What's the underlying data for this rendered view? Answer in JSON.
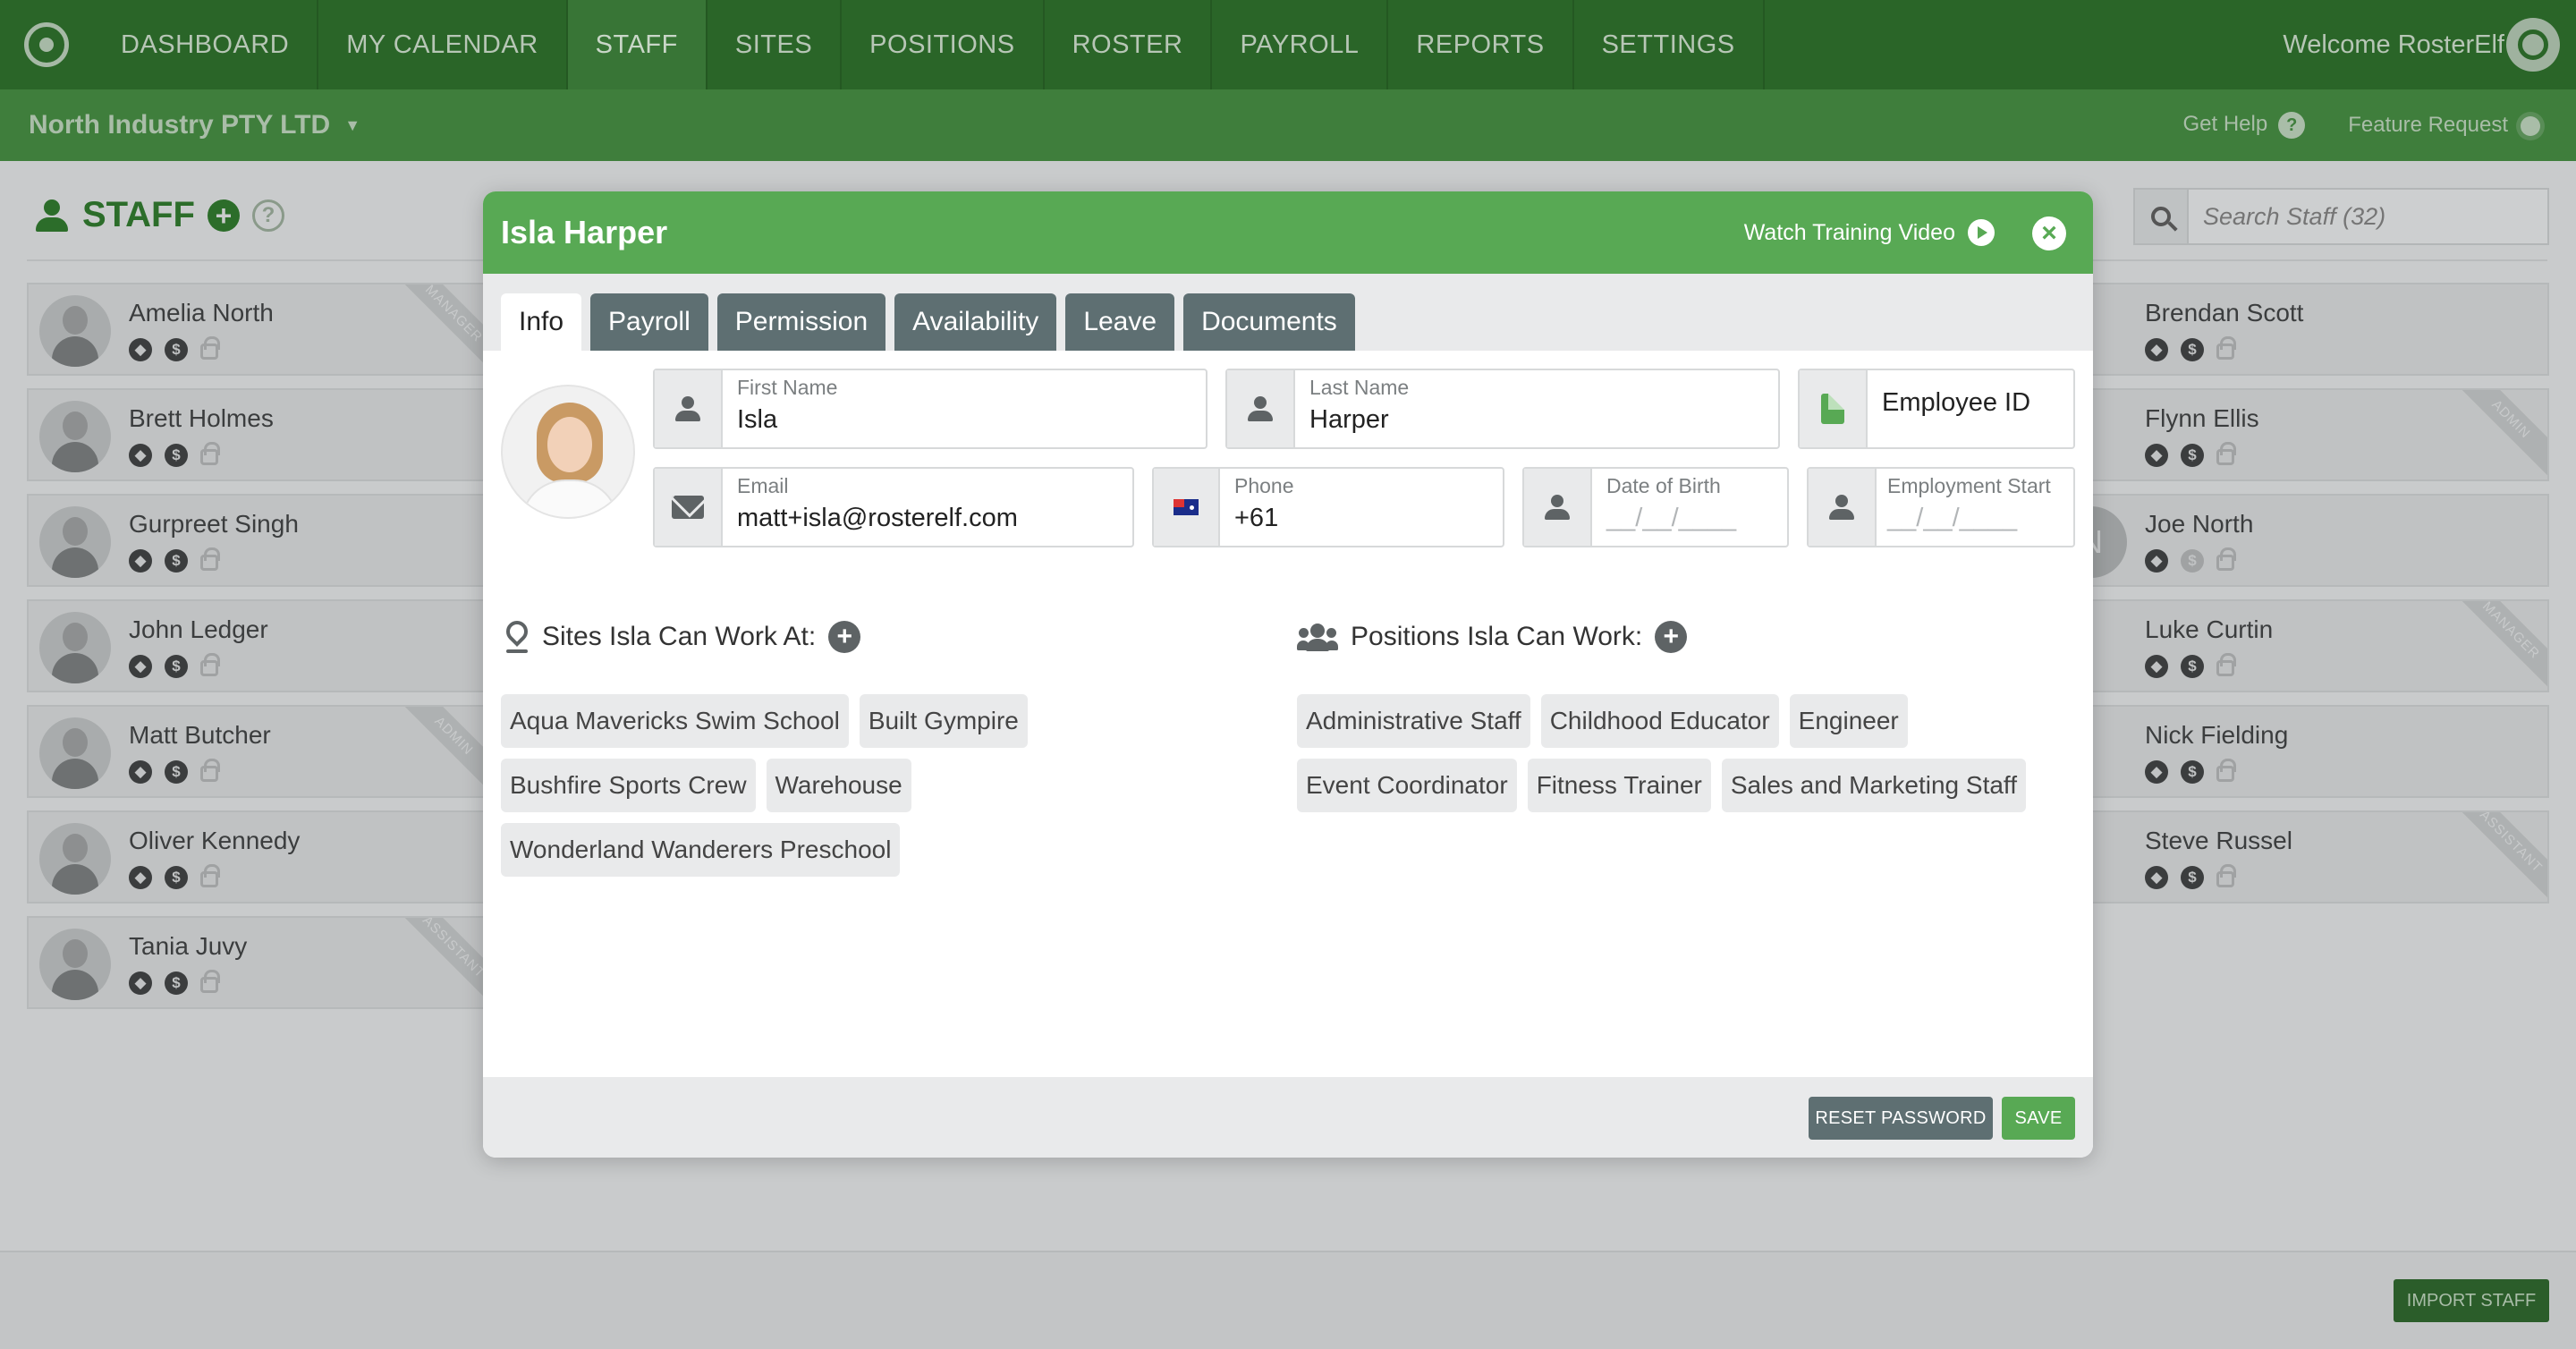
{
  "nav": {
    "items": [
      {
        "label": "DASHBOARD"
      },
      {
        "label": "MY CALENDAR"
      },
      {
        "label": "STAFF",
        "active": true
      },
      {
        "label": "SITES"
      },
      {
        "label": "POSITIONS"
      },
      {
        "label": "ROSTER"
      },
      {
        "label": "PAYROLL"
      },
      {
        "label": "REPORTS"
      },
      {
        "label": "SETTINGS"
      }
    ],
    "welcome": "Welcome RosterElf"
  },
  "subbar": {
    "company": "North Industry PTY LTD",
    "get_help": "Get Help",
    "help_mark": "?",
    "feature_request": "Feature Request"
  },
  "page": {
    "title": "STAFF",
    "add_mark": "+",
    "help_mark": "?",
    "search_placeholder": "Search Staff (32)",
    "import_button": "IMPORT STAFF"
  },
  "staff_left": [
    {
      "name": "Amelia North",
      "ribbon": "MANAGER"
    },
    {
      "name": "Brett Holmes",
      "ribbon": ""
    },
    {
      "name": "Gurpreet Singh",
      "ribbon": ""
    },
    {
      "name": "John Ledger",
      "ribbon": ""
    },
    {
      "name": "Matt Butcher",
      "ribbon": "ADMIN"
    },
    {
      "name": "Oliver Kennedy",
      "ribbon": ""
    },
    {
      "name": "Tania Juvy",
      "ribbon": "ASSISTANT"
    }
  ],
  "staff_right": [
    {
      "name": "Brendan Scott",
      "ribbon": ""
    },
    {
      "name": "Flynn Ellis",
      "ribbon": "ADMIN"
    },
    {
      "name": "Joe North",
      "ribbon": "",
      "initial": "N"
    },
    {
      "name": "Luke Curtin",
      "ribbon": "MANAGER"
    },
    {
      "name": "Nick Fielding",
      "ribbon": ""
    },
    {
      "name": "Steve Russel",
      "ribbon": "ASSISTANT"
    }
  ],
  "modal": {
    "title": "Isla Harper",
    "watch_video": "Watch Training Video",
    "close_mark": "×",
    "tabs": [
      {
        "label": "Info",
        "active": true
      },
      {
        "label": "Payroll"
      },
      {
        "label": "Permission"
      },
      {
        "label": "Availability"
      },
      {
        "label": "Leave"
      },
      {
        "label": "Documents"
      }
    ],
    "fields": {
      "first_name": {
        "label": "First Name",
        "value": "Isla"
      },
      "last_name": {
        "label": "Last Name",
        "value": "Harper"
      },
      "employee_id": {
        "placeholder": "Employee ID"
      },
      "email": {
        "label": "Email",
        "value": "matt+isla@rosterelf.com"
      },
      "phone": {
        "label": "Phone",
        "value": "+61"
      },
      "dob": {
        "label": "Date of Birth",
        "value": "__/__/____"
      },
      "employment_start": {
        "label": "Employment Start",
        "value": "__/__/____"
      }
    },
    "sites_heading": "Sites Isla Can Work At:",
    "sites": [
      "Aqua Mavericks Swim School",
      "Built Gympire",
      "Bushfire Sports Crew",
      "Warehouse",
      "Wonderland Wanderers Preschool"
    ],
    "positions_heading": "Positions Isla Can Work:",
    "positions": [
      "Administrative Staff",
      "Childhood Educator",
      "Engineer",
      "Event Coordinator",
      "Fitness Trainer",
      "Sales and Marketing Staff"
    ],
    "add_mark": "+",
    "reset_password": "RESET PASSWORD",
    "save": "SAVE"
  },
  "colors": {
    "brand_green": "#58a954",
    "nav_green": "#2a6528",
    "tab_gray": "#5e6f72"
  }
}
